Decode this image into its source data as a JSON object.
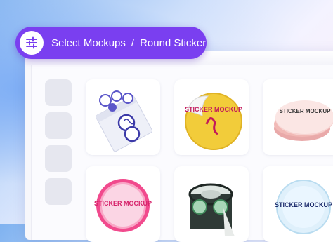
{
  "header": {
    "breadcrumb_root": "Select Mockups",
    "separator": "/",
    "breadcrumb_current": "Round Sticker",
    "icon": "sliders-icon",
    "accent_color": "#7a3ff0"
  },
  "mockups": [
    {
      "id": "sticker-pack",
      "kind": "envelope-with-stickers"
    },
    {
      "id": "yellow-peel-sticker",
      "text": "STICKER MOCKUP"
    },
    {
      "id": "pink-stack-sticker",
      "text": "STICKER MOCKUP"
    },
    {
      "id": "pink-badge-sticker",
      "text": "STICKER MOCKUP"
    },
    {
      "id": "sticker-roll",
      "kind": "roll"
    },
    {
      "id": "clear-sticker",
      "text": "STICKER MOCKUP"
    }
  ]
}
